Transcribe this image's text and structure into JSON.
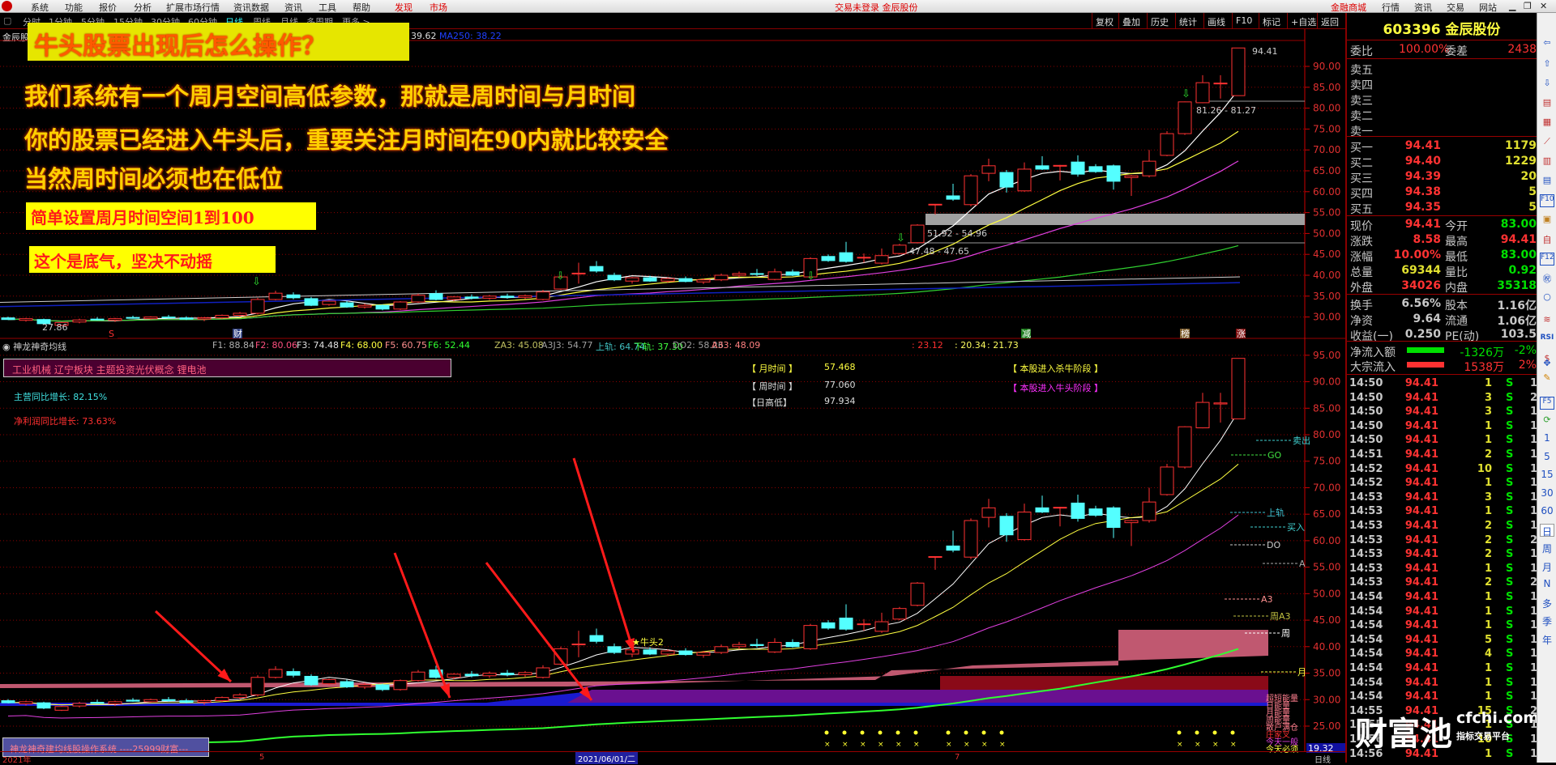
{
  "menu": {
    "items": [
      "系统",
      "功能",
      "报价",
      "分析",
      "扩展市场行情",
      "资讯数据",
      "资讯",
      "工具",
      "帮助"
    ],
    "highlight_items": [
      "发现",
      "市场"
    ],
    "center_status": "交易未登录  金辰股份",
    "right_items": [
      "金融商城",
      "行情",
      "资讯",
      "交易",
      "网站"
    ]
  },
  "periods": {
    "items": [
      "分时",
      "1分钟",
      "5分钟",
      "15分钟",
      "30分钟",
      "60分钟",
      "日线",
      "周线",
      "月线",
      "多周期",
      "更多 >"
    ],
    "active": "日线"
  },
  "toolbar": [
    "复权",
    "叠加",
    "历史",
    "统计",
    "画线",
    "F10",
    "标记",
    "+自选",
    "返回"
  ],
  "ma_header": {
    "stock": "金辰股",
    "ma_partial": "39.62",
    "ma250": "MA250: 38.22"
  },
  "overlay": {
    "title": "牛头股票出现后怎么操作？",
    "lines": [
      "我们系统有一个周月空间高低参数，那就是周时间与月时间",
      "你的股票已经进入牛头后，重要关注月时间在90内就比较安全",
      "当然周时间必须也在低位"
    ],
    "box1": "简单设置周月时间空间1到100",
    "box2": "这个是底气，坚决不动摇"
  },
  "top_chart": {
    "axis_ticks": [
      "90.00",
      "85.00",
      "80.00",
      "75.00",
      "70.00",
      "65.00",
      "60.00",
      "55.00",
      "50.00",
      "45.00",
      "40.00",
      "35.00",
      "30.00"
    ],
    "labels": {
      "high": "94.41",
      "range1": "81.26 - 81.27",
      "range2": "51.92 - 54.96",
      "range3": "47.48 - 47.65",
      "low": "27.86"
    },
    "markers": [
      "S",
      "财",
      "减",
      "榜",
      "涨"
    ]
  },
  "indicator": {
    "name": "神龙神奇均线",
    "values": [
      {
        "t": "F1: 88.84",
        "c": "#b0b0b0"
      },
      {
        "t": "F2: 80.06",
        "c": "#ff5080"
      },
      {
        "t": "F3: 74.48",
        "c": "#e0e0e0"
      },
      {
        "t": "F4: 68.00",
        "c": "#ffff40"
      },
      {
        "t": "F5: 60.75",
        "c": "#ff9090"
      },
      {
        "t": "F6: 52.44",
        "c": "#30ff30"
      },
      {
        "t": "ZA3: 45.08",
        "c": "#c0c060"
      },
      {
        "t": "A3J3: 54.77",
        "c": "#a0a0a0"
      },
      {
        "t": "上轨: 64.74",
        "c": "#40c0c0"
      },
      {
        "t": "下轨: 37.30",
        "c": "#40ff40"
      },
      {
        "t": "DO2: 58.26",
        "c": "#a0a0a0"
      },
      {
        "t": "A33: 48.09",
        "c": "#ff8080"
      },
      {
        "t": ": 23.12",
        "c": "#ff3030"
      },
      {
        "t": ": 20.34",
        "c": "#ffff60"
      },
      {
        "t": ": 21.73",
        "c": "#ffff60"
      }
    ],
    "sector": "工业机械 辽宁板块 主题投资光伏概念 锂电池",
    "main_growth": "主营同比增长: 82.15%",
    "profit_growth": "净利润同比增长: 73.63%",
    "month_time_label": "【 月时间 】",
    "month_time": "57.468",
    "week_time_label": "【 周时间 】",
    "week_time": "77.060",
    "day_hl_label": "【日高低】",
    "day_hl": "97.934",
    "stage1": "【 本股进入杀牛阶段 】",
    "stage2": "【 本股进入牛头阶段 】",
    "star_label": "★牛头2",
    "system_box": "神龙神奇建均线股操作系统 ----25999财富---",
    "axis_ticks": [
      "95.00",
      "90.00",
      "85.00",
      "80.00",
      "75.00",
      "70.00",
      "65.00",
      "60.00",
      "55.00",
      "50.00",
      "45.00",
      "40.00",
      "35.00",
      "30.00",
      "25.00"
    ],
    "right_labels": [
      "卖出",
      "GO",
      "上轨",
      "买入",
      "DO",
      "A",
      "A3",
      "周A3",
      "周",
      "月"
    ],
    "legend": [
      "超短能量",
      "日能量",
      "月能量",
      "周能量",
      "散户满仓",
      "庄家叉",
      "今天一般",
      "今天必须"
    ],
    "current_value": "19.32"
  },
  "date_axis": {
    "start": "2021年",
    "m5": "5",
    "cursor": "2021/06/01/二",
    "m7": "7",
    "period": "日线"
  },
  "quote": {
    "code_name": "603396 金辰股份",
    "weibi_label": "委比",
    "weibi": "100.00%",
    "weicha_label": "委差",
    "weicha": "2438",
    "asks": [
      "卖五",
      "卖四",
      "卖三",
      "卖二",
      "卖一"
    ],
    "bids": [
      {
        "label": "买一",
        "price": "94.41",
        "vol": "1179"
      },
      {
        "label": "买二",
        "price": "94.40",
        "vol": "1229"
      },
      {
        "label": "买三",
        "price": "94.39",
        "vol": "20"
      },
      {
        "label": "买四",
        "price": "94.38",
        "vol": "5"
      },
      {
        "label": "买五",
        "price": "94.35",
        "vol": "5"
      }
    ],
    "stats": [
      {
        "l1": "现价",
        "v1": "94.41",
        "c1": "red",
        "l2": "今开",
        "v2": "83.00",
        "c2": "grn"
      },
      {
        "l1": "涨跌",
        "v1": "8.58",
        "c1": "red",
        "l2": "最高",
        "v2": "94.41",
        "c2": "red"
      },
      {
        "l1": "涨幅",
        "v1": "10.00%",
        "c1": "red",
        "l2": "最低",
        "v2": "83.00",
        "c2": "grn"
      },
      {
        "l1": "总量",
        "v1": "69344",
        "c1": "yel",
        "l2": "量比",
        "v2": "0.92",
        "c2": "grn"
      },
      {
        "l1": "外盘",
        "v1": "34026",
        "c1": "red",
        "l2": "内盘",
        "v2": "35318",
        "c2": "grn"
      },
      {
        "l1": "换手",
        "v1": "6.56%",
        "c1": "wht",
        "l2": "股本",
        "v2": "1.16亿",
        "c2": "wht"
      },
      {
        "l1": "净资",
        "v1": "9.64",
        "c1": "wht",
        "l2": "流通",
        "v2": "1.06亿",
        "c2": "wht"
      },
      {
        "l1": "收益(一)",
        "v1": "0.250",
        "c1": "wht",
        "l2": "PE(动)",
        "v2": "103.5",
        "c2": "wht"
      }
    ],
    "flows": [
      {
        "label": "净流入额",
        "amount": "-1326万",
        "pct": "-2%",
        "color": "#00e000"
      },
      {
        "label": "大宗流入",
        "amount": "1538万",
        "pct": "2%",
        "color": "#ff3232"
      }
    ],
    "trades": [
      [
        "14:50",
        "94.41",
        "1",
        "S",
        "1"
      ],
      [
        "14:50",
        "94.41",
        "3",
        "S",
        "2"
      ],
      [
        "14:50",
        "94.41",
        "3",
        "S",
        "1"
      ],
      [
        "14:50",
        "94.41",
        "1",
        "S",
        "1"
      ],
      [
        "14:50",
        "94.41",
        "1",
        "S",
        "1"
      ],
      [
        "14:51",
        "94.41",
        "2",
        "S",
        "1"
      ],
      [
        "14:52",
        "94.41",
        "10",
        "S",
        "1"
      ],
      [
        "14:52",
        "94.41",
        "1",
        "S",
        "1"
      ],
      [
        "14:53",
        "94.41",
        "3",
        "S",
        "1"
      ],
      [
        "14:53",
        "94.41",
        "1",
        "S",
        "1"
      ],
      [
        "14:53",
        "94.41",
        "2",
        "S",
        "1"
      ],
      [
        "14:53",
        "94.41",
        "2",
        "S",
        "2"
      ],
      [
        "14:53",
        "94.41",
        "2",
        "S",
        "1"
      ],
      [
        "14:53",
        "94.41",
        "1",
        "S",
        "1"
      ],
      [
        "14:53",
        "94.41",
        "2",
        "S",
        "2"
      ],
      [
        "14:54",
        "94.41",
        "1",
        "S",
        "1"
      ],
      [
        "14:54",
        "94.41",
        "1",
        "S",
        "1"
      ],
      [
        "14:54",
        "94.41",
        "1",
        "S",
        "1"
      ],
      [
        "14:54",
        "94.41",
        "5",
        "S",
        "1"
      ],
      [
        "14:54",
        "94.41",
        "4",
        "S",
        "1"
      ],
      [
        "14:54",
        "94.41",
        "1",
        "S",
        "1"
      ],
      [
        "14:54",
        "94.41",
        "1",
        "S",
        "1"
      ],
      [
        "14:54",
        "94.41",
        "1",
        "S",
        "1"
      ],
      [
        "14:55",
        "94.41",
        "15",
        "S",
        "2"
      ],
      [
        "14:55",
        "94.41",
        "1",
        "S",
        "1"
      ],
      [
        "14:56",
        "94.41",
        "10",
        "S",
        "1"
      ],
      [
        "14:56",
        "94.41",
        "1",
        "S",
        "1"
      ]
    ]
  },
  "iconbar": {
    "numbers": [
      "1",
      "5",
      "15",
      "30",
      "60",
      "日",
      "周",
      "月",
      "N",
      "多",
      "季",
      "年"
    ],
    "active": "日"
  },
  "watermark": {
    "brand": "财富池",
    "site": "cfchi.com",
    "tagline": "指标交易平台"
  },
  "colors": {
    "up": "#ff3232",
    "down": "#54ffff",
    "grid": "#8b0000",
    "ma5": "#ffffff",
    "ma10": "#ffff40",
    "ma20": "#e040e0",
    "ma60": "#30d030",
    "ma250": "#1020c0"
  },
  "candles": [
    [
      29.8,
      30.1,
      29.3,
      29.4
    ],
    [
      29.2,
      29.8,
      28.9,
      29.6
    ],
    [
      29.4,
      29.6,
      28.2,
      28.4
    ],
    [
      28.0,
      28.8,
      27.86,
      28.7
    ],
    [
      28.8,
      29.6,
      28.5,
      29.3
    ],
    [
      29.5,
      30.0,
      29.2,
      29.3
    ],
    [
      29.2,
      29.8,
      28.8,
      29.6
    ],
    [
      29.9,
      30.3,
      29.6,
      29.7
    ],
    [
      29.6,
      30.2,
      29.4,
      30.0
    ],
    [
      30.0,
      30.5,
      29.6,
      29.8
    ],
    [
      29.8,
      30.2,
      29.3,
      29.5
    ],
    [
      29.5,
      30.0,
      29.0,
      29.8
    ],
    [
      29.8,
      30.6,
      29.5,
      30.4
    ],
    [
      30.4,
      31.2,
      30.1,
      30.9
    ],
    [
      30.9,
      34.6,
      30.6,
      34.2
    ],
    [
      34.2,
      36.3,
      34.0,
      35.7
    ],
    [
      35.3,
      35.9,
      34.2,
      34.6
    ],
    [
      34.4,
      34.8,
      32.6,
      32.8
    ],
    [
      33.0,
      34.0,
      32.7,
      33.8
    ],
    [
      33.4,
      33.8,
      32.2,
      32.4
    ],
    [
      32.4,
      33.2,
      32.0,
      32.8
    ],
    [
      32.8,
      33.0,
      31.6,
      31.9
    ],
    [
      31.9,
      33.8,
      31.7,
      33.6
    ],
    [
      33.6,
      35.6,
      33.4,
      35.2
    ],
    [
      35.6,
      36.4,
      34.0,
      34.2
    ],
    [
      34.2,
      35.0,
      33.8,
      34.8
    ],
    [
      34.8,
      35.4,
      34.2,
      34.5
    ],
    [
      34.5,
      35.3,
      34.1,
      35.0
    ],
    [
      35.0,
      35.6,
      34.4,
      34.7
    ],
    [
      34.7,
      35.4,
      34.3,
      35.1
    ],
    [
      34.2,
      36.5,
      34.0,
      36.0
    ],
    [
      36.7,
      40.0,
      36.5,
      39.6
    ],
    [
      40.5,
      43.0,
      38.0,
      40.5
    ],
    [
      42.1,
      43.4,
      40.6,
      41.0
    ],
    [
      40.0,
      40.6,
      38.6,
      38.9
    ],
    [
      38.6,
      39.6,
      38.0,
      39.4
    ],
    [
      39.4,
      39.9,
      38.4,
      38.6
    ],
    [
      38.6,
      39.5,
      38.2,
      39.2
    ],
    [
      39.2,
      39.7,
      38.3,
      38.5
    ],
    [
      38.4,
      39.2,
      37.9,
      38.9
    ],
    [
      38.9,
      40.4,
      38.6,
      40.0
    ],
    [
      40.0,
      40.9,
      39.5,
      40.4
    ],
    [
      40.4,
      41.5,
      39.8,
      40.2
    ],
    [
      39.0,
      41.6,
      38.8,
      40.8
    ],
    [
      40.8,
      41.4,
      39.8,
      40.0
    ],
    [
      39.6,
      44.3,
      39.4,
      44.0
    ],
    [
      44.5,
      45.0,
      43.2,
      43.5
    ],
    [
      45.4,
      48.0,
      43.0,
      43.3
    ],
    [
      44.3,
      45.2,
      43.0,
      44.3
    ],
    [
      42.9,
      46.4,
      42.6,
      44.7
    ],
    [
      45.2,
      47.5,
      45.0,
      47.2
    ],
    [
      47.8,
      52.2,
      47.6,
      52.0
    ],
    [
      57.0,
      57.0,
      54.5,
      57.0
    ],
    [
      59.0,
      61.9,
      57.8,
      58.2
    ],
    [
      56.9,
      64.2,
      56.5,
      63.8
    ],
    [
      64.4,
      67.9,
      62.5,
      66.2
    ],
    [
      64.6,
      65.2,
      59.8,
      61.1
    ],
    [
      60.2,
      67.0,
      60.0,
      65.4
    ],
    [
      66.2,
      68.5,
      65.2,
      65.4
    ],
    [
      66.2,
      66.4,
      62.7,
      66.3
    ],
    [
      67.1,
      68.7,
      63.6,
      64.2
    ],
    [
      66.0,
      66.6,
      64.5,
      64.8
    ],
    [
      66.2,
      66.5,
      60.5,
      62.5
    ],
    [
      63.4,
      64.0,
      59.0,
      63.8
    ],
    [
      63.8,
      70.0,
      63.4,
      67.3
    ],
    [
      68.7,
      74.5,
      68.5,
      73.9
    ],
    [
      73.9,
      81.6,
      73.6,
      81.5
    ],
    [
      81.3,
      87.9,
      81.2,
      86.1
    ],
    [
      85.8,
      87.9,
      82.3,
      86.0
    ],
    [
      83.0,
      94.41,
      83.0,
      94.41
    ]
  ]
}
